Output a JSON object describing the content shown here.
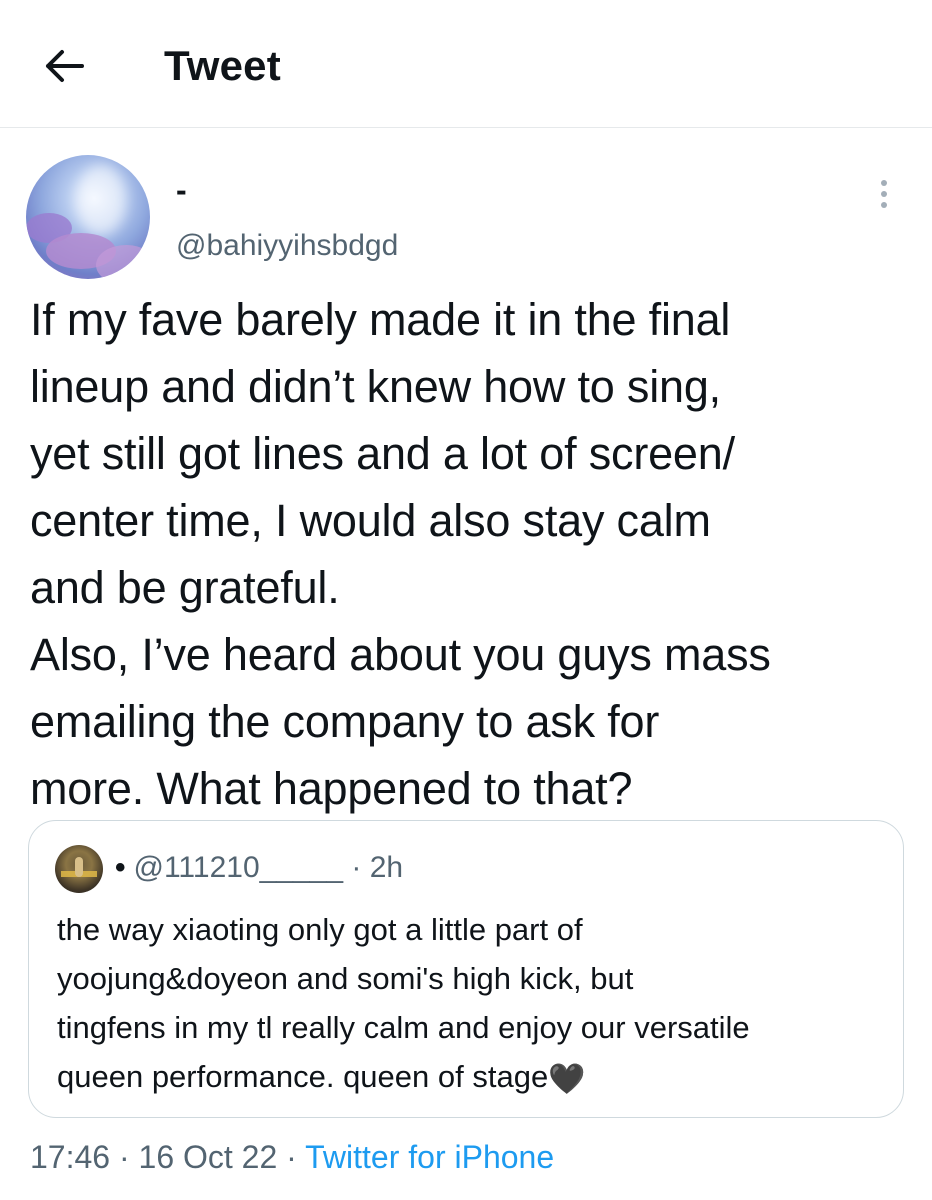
{
  "header": {
    "title": "Tweet",
    "back_icon": "arrow-left-icon"
  },
  "tweet": {
    "author": {
      "display_name": "-",
      "handle": "@bahiyyihsbdgd"
    },
    "text": "If my fave barely made it in the final\nlineup and didn’t knew how to sing,\nyet still got lines and a lot of screen/\ncenter time, I would also stay calm\nand be grateful.\nAlso, I’ve heard about you guys mass\nemailing the company to ask for\nmore. What happened to that?",
    "more_icon": "more-vertical-icon",
    "time": "17:46",
    "date": "16 Oct 22",
    "source": "Twitter for iPhone",
    "separator": "·"
  },
  "quoted_tweet": {
    "handle": "@111210_____",
    "time_ago": "· 2h",
    "bullet": "•",
    "text": "the way xiaoting only got a little part of\nyoojung&doyeon and somi's high kick, but\ntingfens in my tl really calm and enjoy our versatile\nqueen performance. queen of stage",
    "emoji": "🖤"
  },
  "colors": {
    "text_primary": "#0f1419",
    "text_secondary": "#536471",
    "link_blue": "#1d9bf0",
    "border": "#cfd9de"
  }
}
